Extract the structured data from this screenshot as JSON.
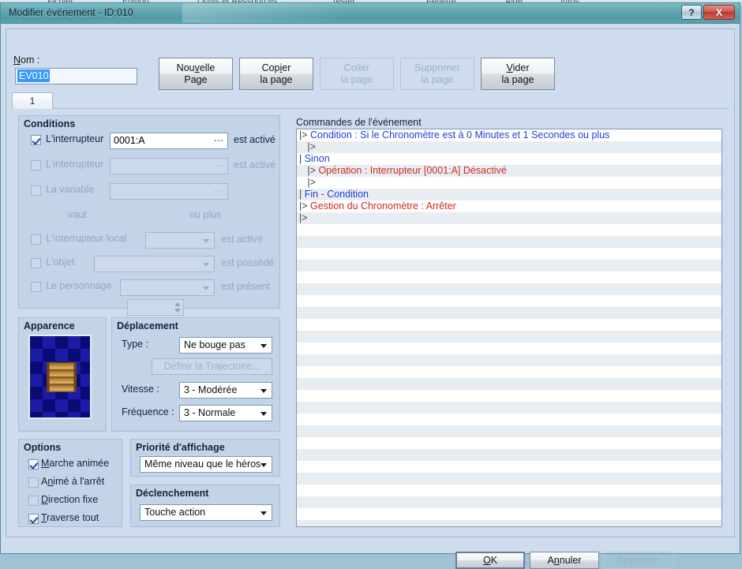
{
  "background_menu": [
    "Fichier",
    "Edition",
    "Outils et Ressources",
    "Tester",
    "Fenêtre",
    "Aide",
    "Infos"
  ],
  "window": {
    "title": "Modifier événement - ID:010",
    "help_button": "?",
    "close_button": "X"
  },
  "name_field": {
    "label": "Nom :",
    "value": "EV010"
  },
  "page_buttons": [
    {
      "line1": "Nouvelle",
      "line2": "Page",
      "enabled": true
    },
    {
      "line1": "Copier",
      "line2": "la page",
      "enabled": true
    },
    {
      "line1": "Coller",
      "line2": "la page",
      "enabled": false
    },
    {
      "line1": "Supprimer",
      "line2": "la page",
      "enabled": false
    },
    {
      "line1": "Vider",
      "line2": "la page",
      "enabled": true
    }
  ],
  "tabs": [
    {
      "label": "1",
      "active": true
    }
  ],
  "conditions": {
    "legend": "Conditions",
    "rows": [
      {
        "checkbox_label": "L'interrupteur",
        "checked": true,
        "value": "0001:A",
        "suffix": "est activé",
        "enabled": true
      },
      {
        "checkbox_label": "L'interrupteur",
        "checked": false,
        "value": "",
        "suffix": "est activé",
        "enabled": false
      },
      {
        "checkbox_label": "La variable",
        "checked": false,
        "value": "",
        "suffix": "",
        "enabled": false
      },
      {
        "checkbox_label": "vaut",
        "checked": false,
        "value": "",
        "suffix": "ou plus",
        "enabled": false
      },
      {
        "checkbox_label": "L'interrupteur local",
        "checked": false,
        "value": "",
        "suffix": "est activé",
        "enabled": false
      },
      {
        "checkbox_label": "L'objet",
        "checked": false,
        "value": "",
        "suffix": "est possédé",
        "enabled": false
      },
      {
        "checkbox_label": "Le personnage",
        "checked": false,
        "value": "",
        "suffix": "est présent",
        "enabled": false
      }
    ]
  },
  "appearance": {
    "legend": "Apparence",
    "sprite_name": "wooden-crate-sprite"
  },
  "movement": {
    "legend": "Déplacement",
    "type_label": "Type :",
    "type_value": "Ne bouge pas",
    "route_button": "Définir la Trajectoire...",
    "speed_label": "Vitesse :",
    "speed_value": "3 - Modérée",
    "frequency_label": "Fréquence :",
    "frequency_value": "3 - Normale"
  },
  "options": {
    "legend": "Options",
    "items": [
      {
        "label": "Marche animée",
        "checked": true
      },
      {
        "label": "Animé à l'arrêt",
        "checked": false
      },
      {
        "label": "Direction fixe",
        "checked": false
      },
      {
        "label": "Traverse tout",
        "checked": true
      }
    ]
  },
  "priority": {
    "legend": "Priorité d'affichage",
    "value": "Même niveau que le héros"
  },
  "trigger": {
    "legend": "Déclenchement",
    "value": "Touche action"
  },
  "commands": {
    "label": "Commandes de l'événement",
    "rows": [
      {
        "prefix": "|>",
        "text": "Condition : Si le Chronomètre est à 0 Minutes et 1 Secondes ou plus",
        "color": "blue",
        "indent": 0
      },
      {
        "prefix": "|>",
        "text": "",
        "color": "blue",
        "indent": 1
      },
      {
        "prefix": "|",
        "text": "Sinon",
        "color": "blue",
        "indent": 0
      },
      {
        "prefix": "|>",
        "text": "Opération : Interrupteur [0001:A] Désactivé",
        "color": "red",
        "indent": 1
      },
      {
        "prefix": "|>",
        "text": "",
        "color": "blue",
        "indent": 1
      },
      {
        "prefix": "|",
        "text": "Fin - Condition",
        "color": "blue",
        "indent": 0
      },
      {
        "prefix": "|>",
        "text": "Gestion du Chronomètre : Arrêter",
        "color": "red",
        "indent": 0
      },
      {
        "prefix": "|>",
        "text": "",
        "color": "blue",
        "indent": 0
      }
    ],
    "empty_row_count": 26
  },
  "footer": {
    "ok": "OK",
    "cancel": "Annuler",
    "apply": "Appliquer"
  },
  "colors": {
    "titlebar": "#5fa5b0",
    "dialog_bg": "#cfdcee",
    "group_bg": "#c3d3e8",
    "command_blue": "#1f3fd6",
    "command_red": "#d22b1e",
    "row_alt": "#e8edf2",
    "selection": "#3399ff"
  }
}
